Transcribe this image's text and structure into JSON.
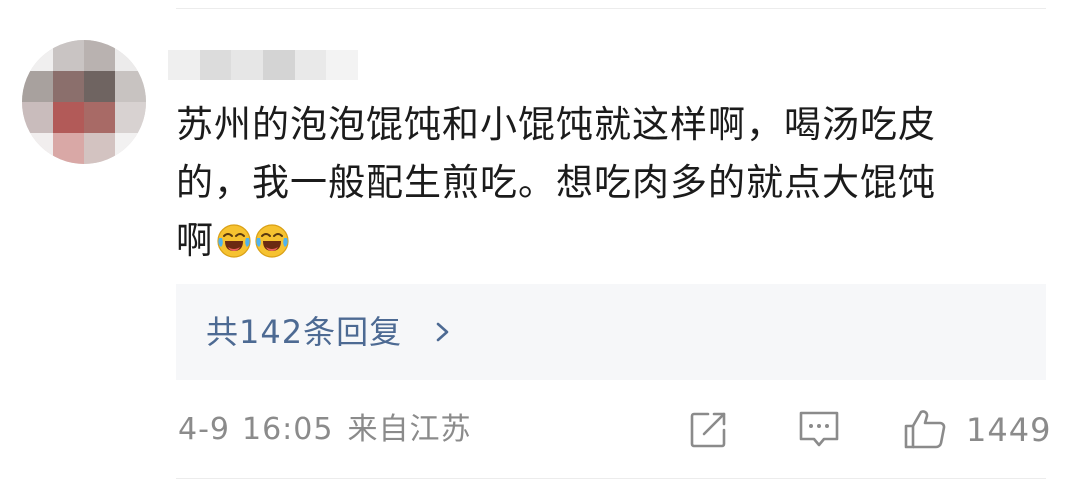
{
  "comment": {
    "line1": "苏州的泡泡馄饨和小馄饨就这样啊，喝汤吃皮",
    "line2": "的，我一般配生煎吃。想吃肉多的就点大馄饨",
    "line3": "啊",
    "emojis": [
      "laugh-cry-emoji",
      "laugh-cry-emoji"
    ]
  },
  "replies": {
    "label": "共142条回复"
  },
  "meta": {
    "date": "4-9",
    "time": "16:05",
    "location": "来自江苏"
  },
  "actions": {
    "share_icon": "share-icon",
    "comment_icon": "comment-icon",
    "like_icon": "thumbs-up-icon",
    "like_count": "1449"
  },
  "colors": {
    "link_blue": "#4d6a93",
    "meta_gray": "#8b8b8b",
    "reply_bg": "#f6f7f9",
    "emoji_yellow": "#f6c230"
  }
}
